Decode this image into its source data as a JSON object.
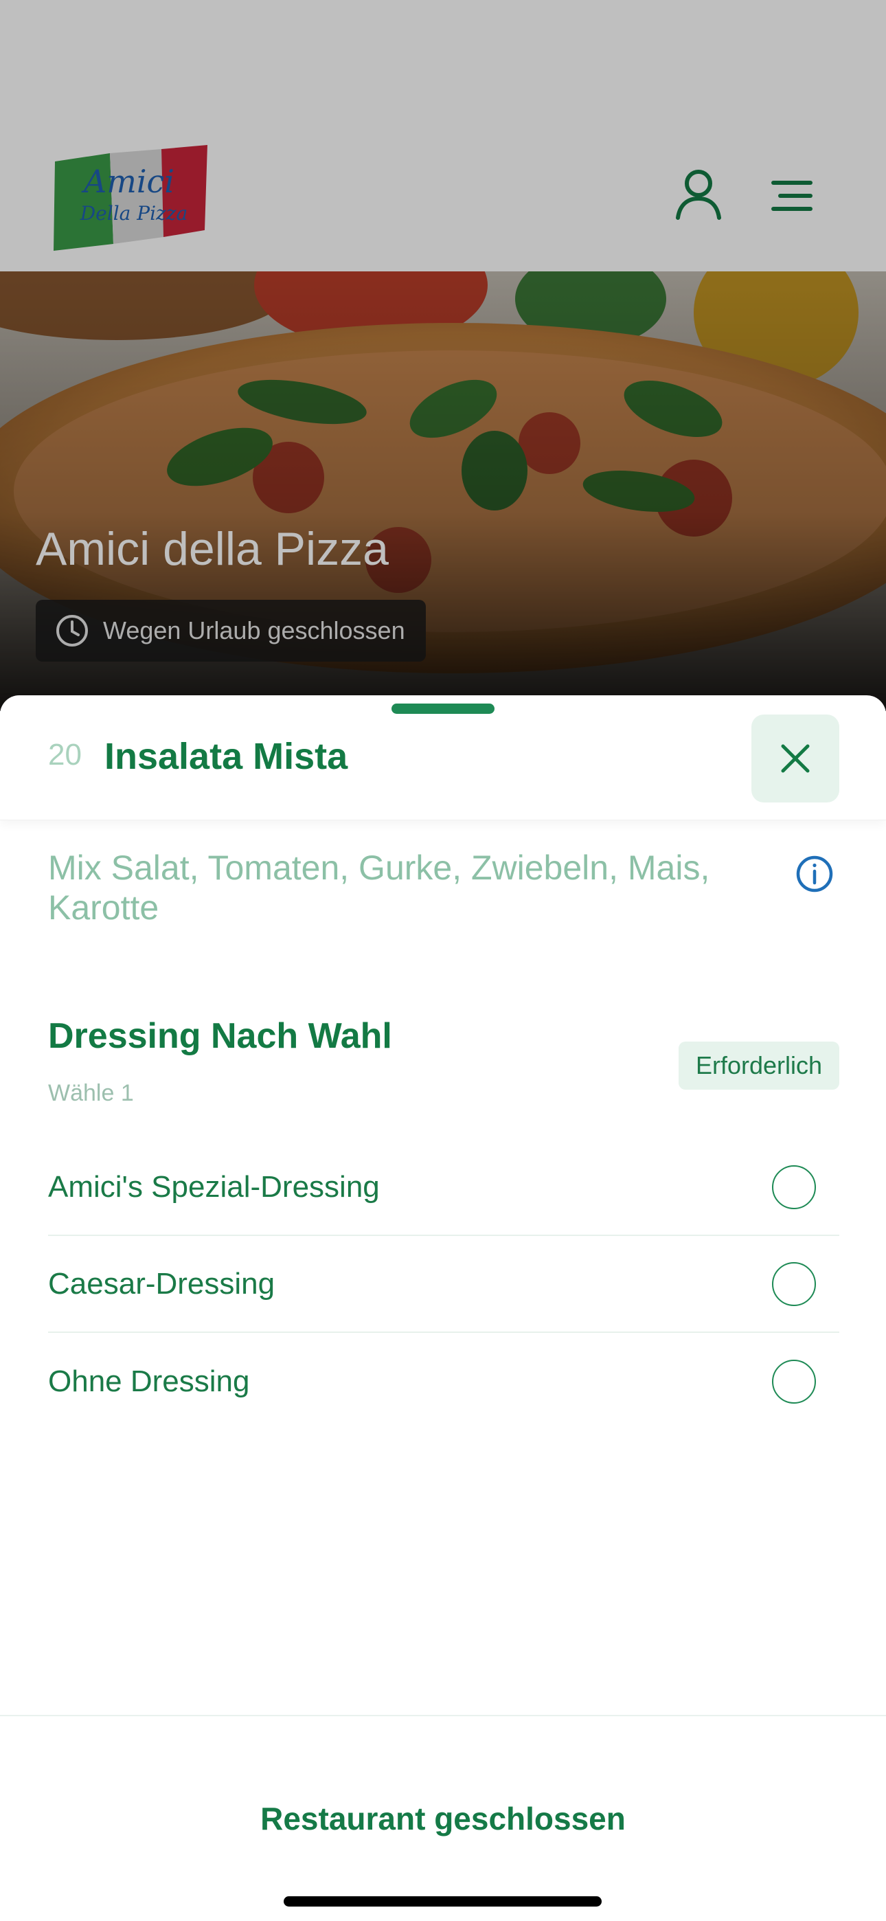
{
  "header": {
    "logo_text_top": "Amici",
    "logo_text_bottom": "Della Pizza"
  },
  "hero": {
    "restaurant_name": "Amici della Pizza",
    "status": "Wegen Urlaub geschlossen"
  },
  "sheet": {
    "item_number": "20",
    "item_name": "Insalata Mista",
    "description": "Mix Salat, Tomaten, Gurke, Zwiebeln, Mais, Karotte"
  },
  "dressing_group": {
    "title": "Dressing Nach Wahl",
    "subtitle": "Wähle 1",
    "badge": "Erforderlich",
    "options": [
      {
        "label": "Amici's Spezial-Dressing"
      },
      {
        "label": "Caesar-Dressing"
      },
      {
        "label": "Ohne Dressing"
      }
    ]
  },
  "footer": {
    "status": "Restaurant geschlossen"
  },
  "colors": {
    "brand_green": "#137a44",
    "light_green_bg": "#e6f3ec",
    "info_blue": "#1f6fb8"
  }
}
